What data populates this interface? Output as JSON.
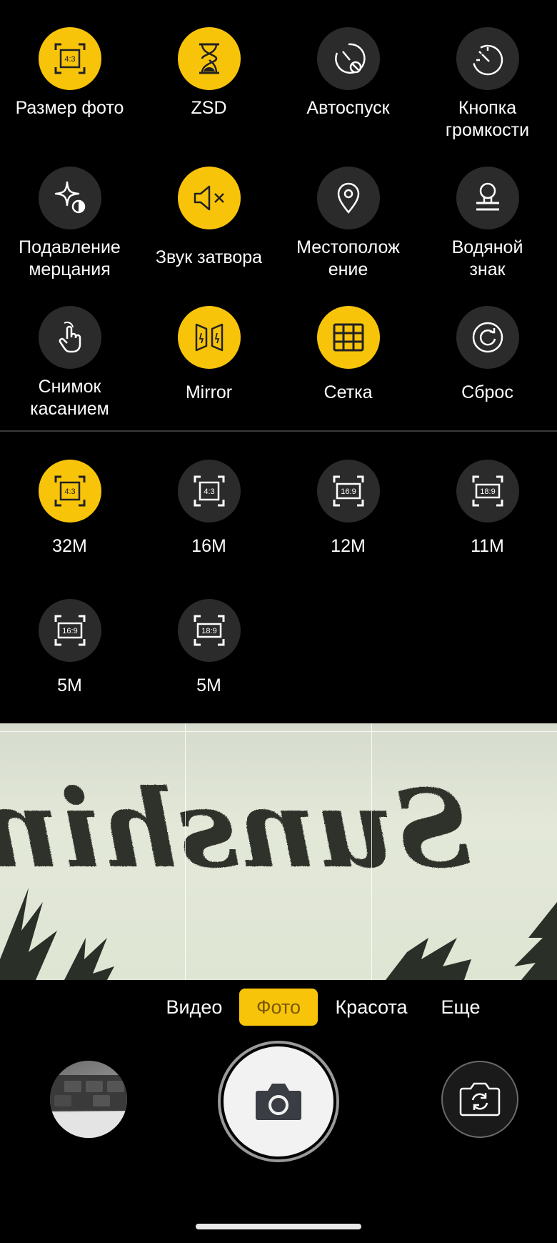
{
  "settings": {
    "photo_size": {
      "label": "Размер фото",
      "badge": "4:3"
    },
    "zsd": {
      "label": "ZSD"
    },
    "timer": {
      "label": "Автоспуск"
    },
    "volume_key": {
      "label": "Кнопка\nгромкости"
    },
    "flicker": {
      "label": "Подавление\nмерцания"
    },
    "shutter_sound": {
      "label": "Звук затвора"
    },
    "location": {
      "label": "Местополож\nение"
    },
    "watermark": {
      "label": "Водяной\nзнак"
    },
    "touch_shot": {
      "label": "Снимок\nкасанием"
    },
    "mirror": {
      "label": "Mirror"
    },
    "grid": {
      "label": "Сетка"
    },
    "reset": {
      "label": "Сброс"
    }
  },
  "photo_sizes": [
    {
      "ratio": "4:3",
      "label": "32M",
      "selected": true
    },
    {
      "ratio": "4:3",
      "label": "16M",
      "selected": false
    },
    {
      "ratio": "16:9",
      "label": "12M",
      "selected": false
    },
    {
      "ratio": "18:9",
      "label": "11M",
      "selected": false
    },
    {
      "ratio": "16:9",
      "label": "5M",
      "selected": false
    },
    {
      "ratio": "18:9",
      "label": "5M",
      "selected": false
    }
  ],
  "viewfinder": {
    "shirt_text": "Sunshine"
  },
  "modes": {
    "video": "Видео",
    "photo": "Фото",
    "beauty": "Красота",
    "more": "Еще",
    "active": "photo"
  },
  "colors": {
    "accent": "#f8c40a",
    "icon_bg": "#2b2b2b",
    "background": "#000000"
  }
}
